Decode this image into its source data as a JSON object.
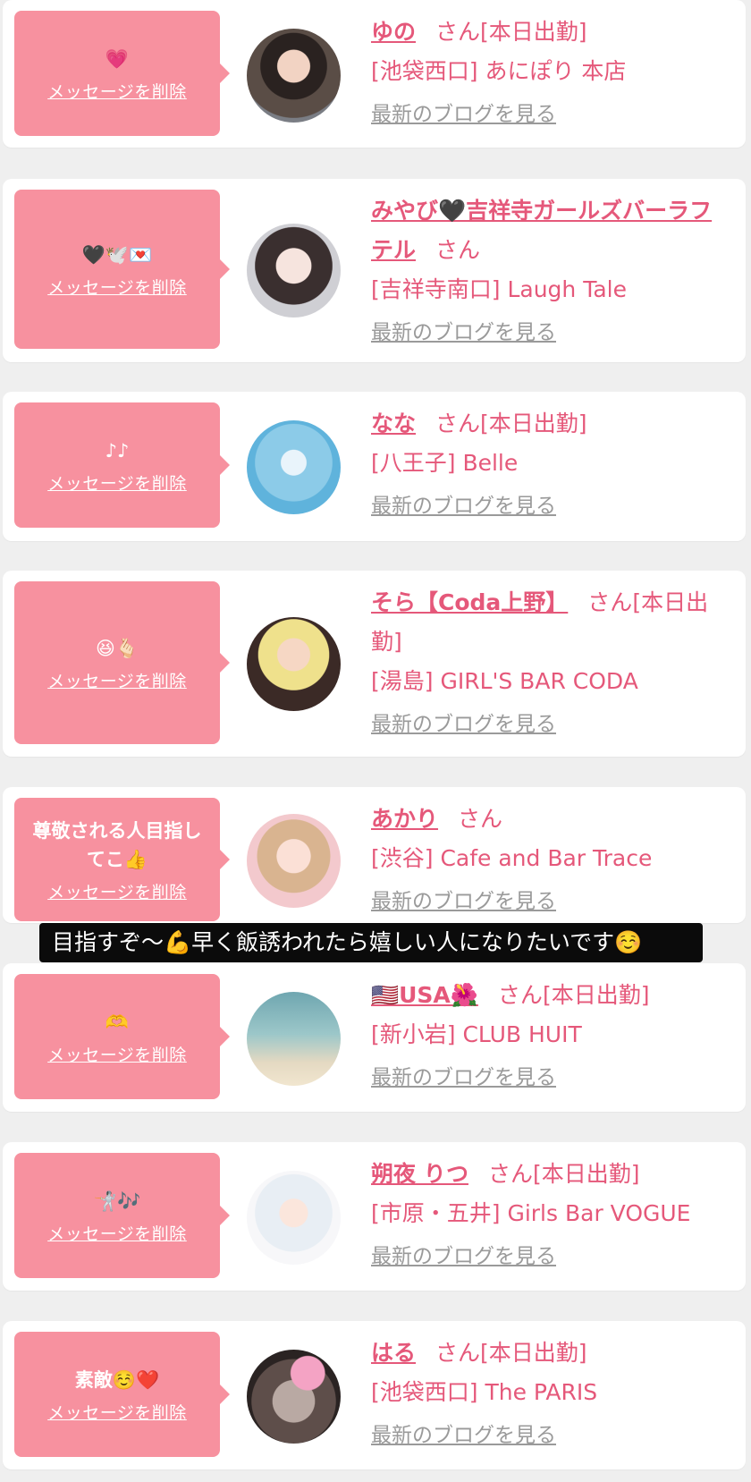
{
  "delete_label": "メッセージを削除",
  "blog_label": "最新のブログを見る",
  "san": "さん",
  "on_duty": "[本日出勤]",
  "caption": "目指すぞ〜💪早く飯誘われたら嬉しい人になりたいです☺️",
  "colors": {
    "bubble": "#f7919f",
    "accent": "#e5587a",
    "link_gray": "#9a9a9a"
  },
  "items": [
    {
      "message": "💗",
      "name": "ゆの",
      "duty": "[本日出勤]",
      "store": "[池袋西口] あにぽり 本店"
    },
    {
      "message": "🖤🕊️💌",
      "name": "みやび🖤吉祥寺ガールズバーラフテル",
      "duty": "",
      "store": "[吉祥寺南口] Laugh Tale"
    },
    {
      "message": "♪♪",
      "name": "なな",
      "duty": "[本日出勤]",
      "store": "[八王子] Belle"
    },
    {
      "message": "😆🫰🏻",
      "name": "そら【Coda上野】",
      "duty": "[本日出勤]",
      "store": "[湯島] GIRL'S BAR CODA"
    },
    {
      "message": "尊敬される人目指してこ👍",
      "name": "あかり",
      "duty": "",
      "store": "[渋谷] Cafe and Bar Trace"
    },
    {
      "message": "🫶",
      "name": "🇺🇸USA🌺",
      "duty": "[本日出勤]",
      "store": "[新小岩] CLUB HUIT"
    },
    {
      "message": "🤺🎶",
      "name": "朔夜 りつ",
      "duty": "[本日出勤]",
      "store": "[市原・五井] Girls Bar VOGUE"
    },
    {
      "message": "素敵☺️❤️",
      "name": "はる",
      "duty": "[本日出勤]",
      "store": "[池袋西口] The PARIS"
    }
  ]
}
